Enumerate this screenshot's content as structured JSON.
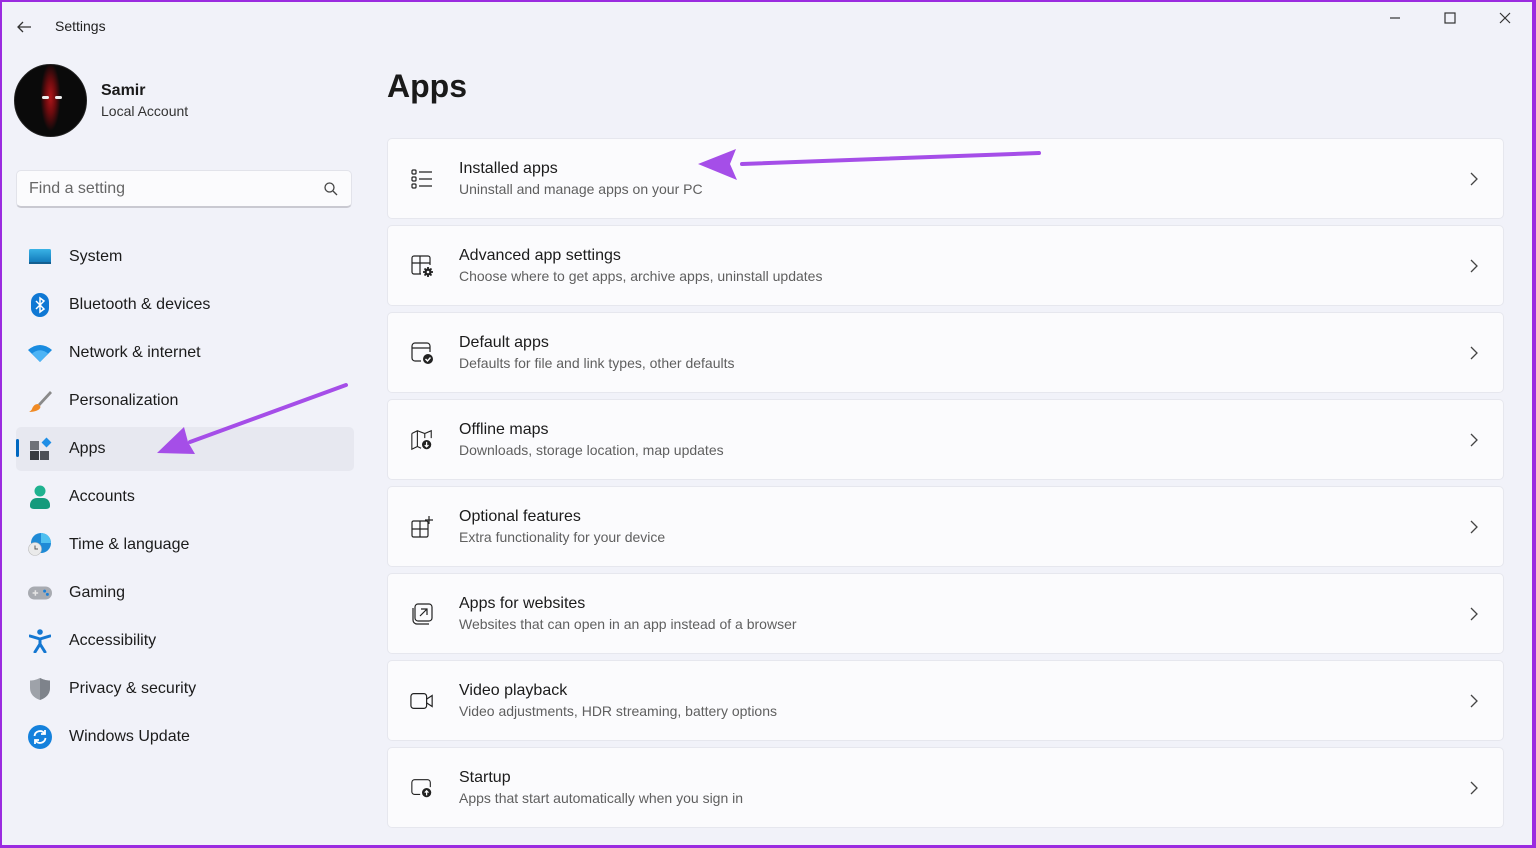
{
  "window": {
    "title": "Settings",
    "controls": {
      "minimize": "minimize-icon",
      "maximize": "maximize-icon",
      "close": "close-icon"
    },
    "border_color": "#9b2be0"
  },
  "profile": {
    "name": "Samir",
    "account_type": "Local Account"
  },
  "search": {
    "placeholder": "Find a setting",
    "value": ""
  },
  "sidebar": {
    "active": "Apps",
    "accent": "#0067c0",
    "items": [
      {
        "label": "System",
        "icon": "system-icon"
      },
      {
        "label": "Bluetooth & devices",
        "icon": "bluetooth-icon"
      },
      {
        "label": "Network & internet",
        "icon": "wifi-icon"
      },
      {
        "label": "Personalization",
        "icon": "paintbrush-icon"
      },
      {
        "label": "Apps",
        "icon": "apps-icon"
      },
      {
        "label": "Accounts",
        "icon": "person-icon"
      },
      {
        "label": "Time & language",
        "icon": "globe-clock-icon"
      },
      {
        "label": "Gaming",
        "icon": "gamepad-icon"
      },
      {
        "label": "Accessibility",
        "icon": "accessibility-icon"
      },
      {
        "label": "Privacy & security",
        "icon": "shield-icon"
      },
      {
        "label": "Windows Update",
        "icon": "update-icon"
      }
    ]
  },
  "main": {
    "title": "Apps",
    "cards": [
      {
        "title": "Installed apps",
        "description": "Uninstall and manage apps on your PC",
        "icon": "list-icon"
      },
      {
        "title": "Advanced app settings",
        "description": "Choose where to get apps, archive apps, uninstall updates",
        "icon": "window-gear-icon"
      },
      {
        "title": "Default apps",
        "description": "Defaults for file and link types, other defaults",
        "icon": "window-check-icon"
      },
      {
        "title": "Offline maps",
        "description": "Downloads, storage location, map updates",
        "icon": "map-download-icon"
      },
      {
        "title": "Optional features",
        "description": "Extra functionality for your device",
        "icon": "grid-plus-icon"
      },
      {
        "title": "Apps for websites",
        "description": "Websites that can open in an app instead of a browser",
        "icon": "open-external-icon"
      },
      {
        "title": "Video playback",
        "description": "Video adjustments, HDR streaming, battery options",
        "icon": "video-camera-icon"
      },
      {
        "title": "Startup",
        "description": "Apps that start automatically when you sign in",
        "icon": "window-startup-icon"
      }
    ]
  },
  "annotations": {
    "arrow_color": "#a54ee8",
    "arrows": [
      "pointing-to-installed-apps",
      "pointing-to-apps-nav"
    ]
  }
}
